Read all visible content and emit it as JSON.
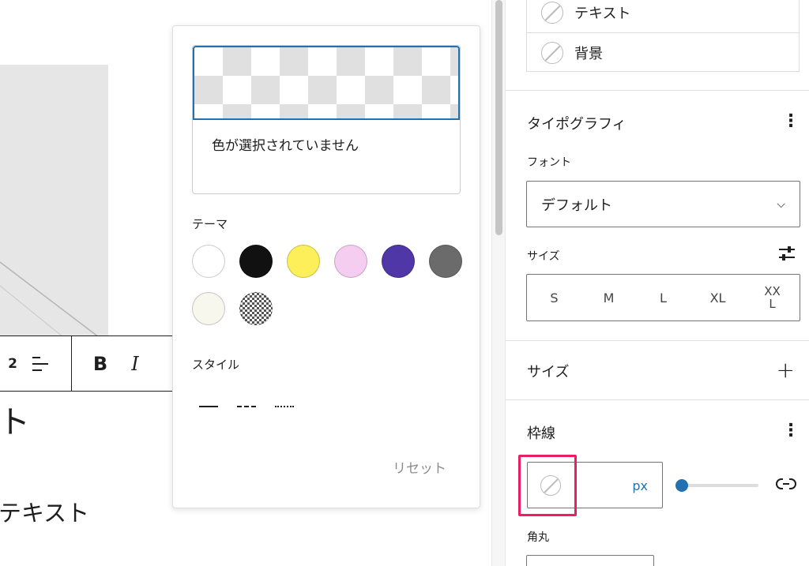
{
  "editor": {
    "heading_fragment": "ト",
    "paragraph_fragment": "テキスト",
    "toolbar": {
      "level_number": "2",
      "bold_label": "B",
      "italic_label": "I"
    }
  },
  "color_popover": {
    "no_color_text": "色が選択されていません",
    "theme_label": "テーマ",
    "theme_colors": [
      "#ffffff",
      "#111111",
      "#fdef5a",
      "#f4cdf0",
      "#4f37a8",
      "#6b6b6b",
      "#f8f7ee",
      "checkered"
    ],
    "style_label": "スタイル",
    "border_styles": [
      "solid",
      "dashed",
      "dotted"
    ],
    "reset_label": "リセット"
  },
  "sidebar": {
    "color_items": [
      "テキスト",
      "背景"
    ],
    "typography": {
      "title": "タイポグラフィ",
      "font_label": "フォント",
      "font_value": "デフォルト",
      "size_label": "サイズ",
      "sizes": [
        "S",
        "M",
        "L",
        "XL",
        "XX\nL"
      ]
    },
    "size_panel": {
      "title": "サイズ"
    },
    "border": {
      "title": "枠線",
      "unit": "px",
      "width_level": 0,
      "radius_label": "角丸"
    }
  },
  "colors": {
    "accent": "#2271b1",
    "highlight": "#e91e63"
  }
}
